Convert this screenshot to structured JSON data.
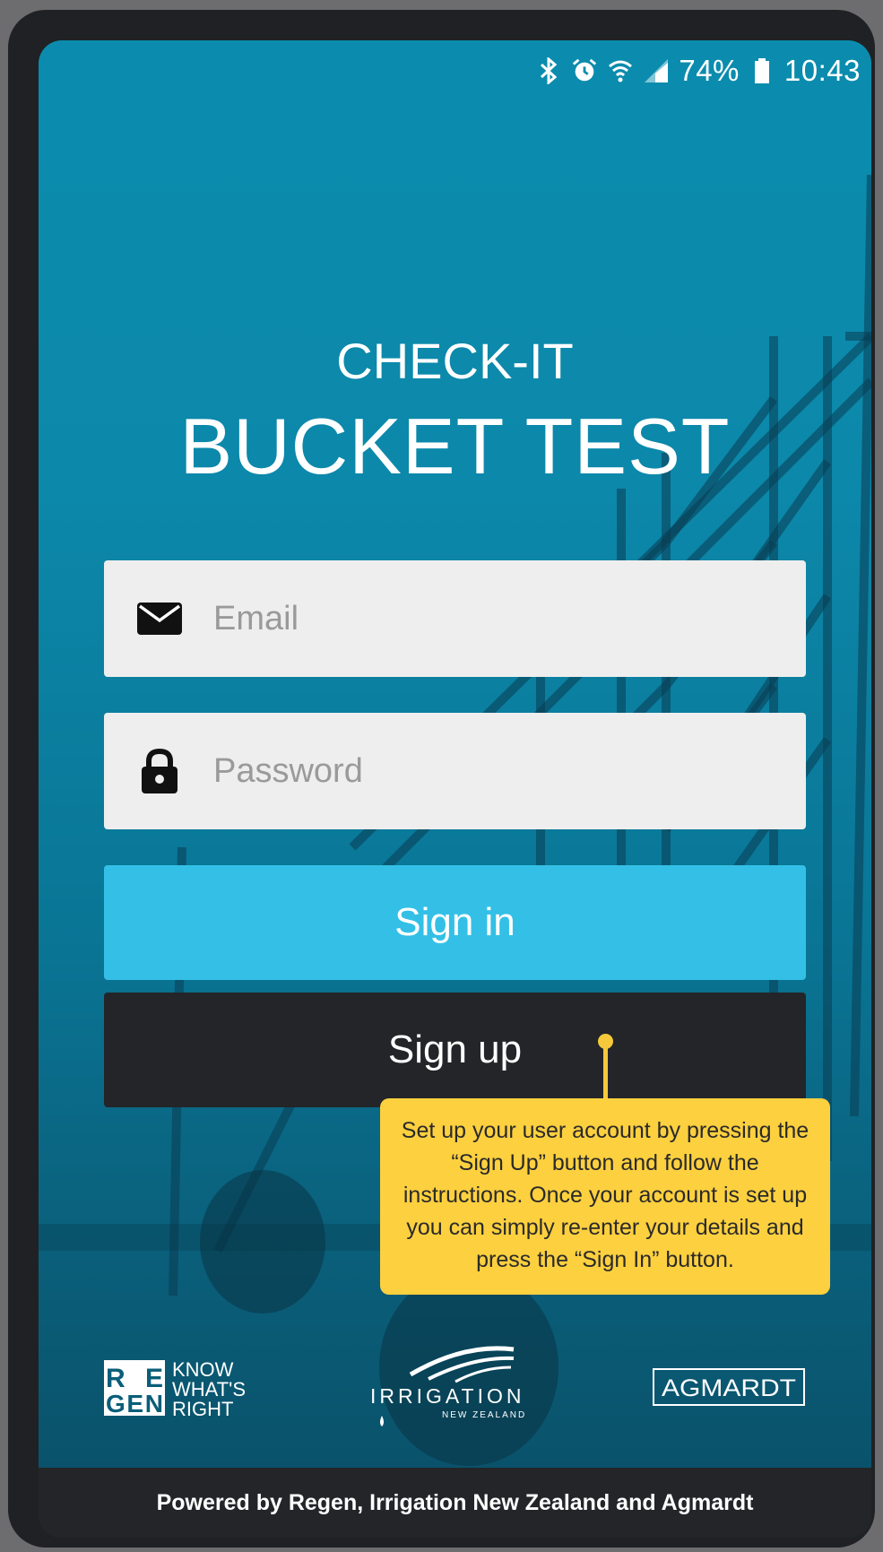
{
  "status_bar": {
    "battery": "74%",
    "time": "10:43"
  },
  "header": {
    "title_line1": "CHECK-IT",
    "title_line2": "BUCKET TEST"
  },
  "form": {
    "email_placeholder": "Email",
    "password_placeholder": "Password",
    "signin_label": "Sign in",
    "signup_label": "Sign up"
  },
  "callout": {
    "text": "Set up your user account by pressing the “Sign Up” button and follow the instructions. Once your account is set up you can simply re-enter your details and press the “Sign In” button."
  },
  "logos": {
    "regen_mark_top": "RE",
    "regen_mark_bottom": "GEN",
    "regen_line1": "KNOW",
    "regen_line2": "WHAT'S",
    "regen_line3": "RIGHT",
    "irrigation_main": "IRRIGATION",
    "irrigation_sub": "NEW ZEALAND",
    "agmardt": "AGMARDT"
  },
  "footer": {
    "text": "Powered by Regen, Irrigation New Zealand and Agmardt"
  },
  "colors": {
    "background_teal": "#0b8cae",
    "signin_button": "#34c0e6",
    "signup_button": "#232528",
    "callout": "#fdd03f",
    "field": "#eeeeee"
  },
  "icons": {
    "bluetooth": "bluetooth-icon",
    "alarm": "alarm-icon",
    "wifi": "wifi-icon",
    "signal": "signal-icon",
    "battery": "battery-icon",
    "email": "envelope-icon",
    "password": "lock-icon"
  }
}
